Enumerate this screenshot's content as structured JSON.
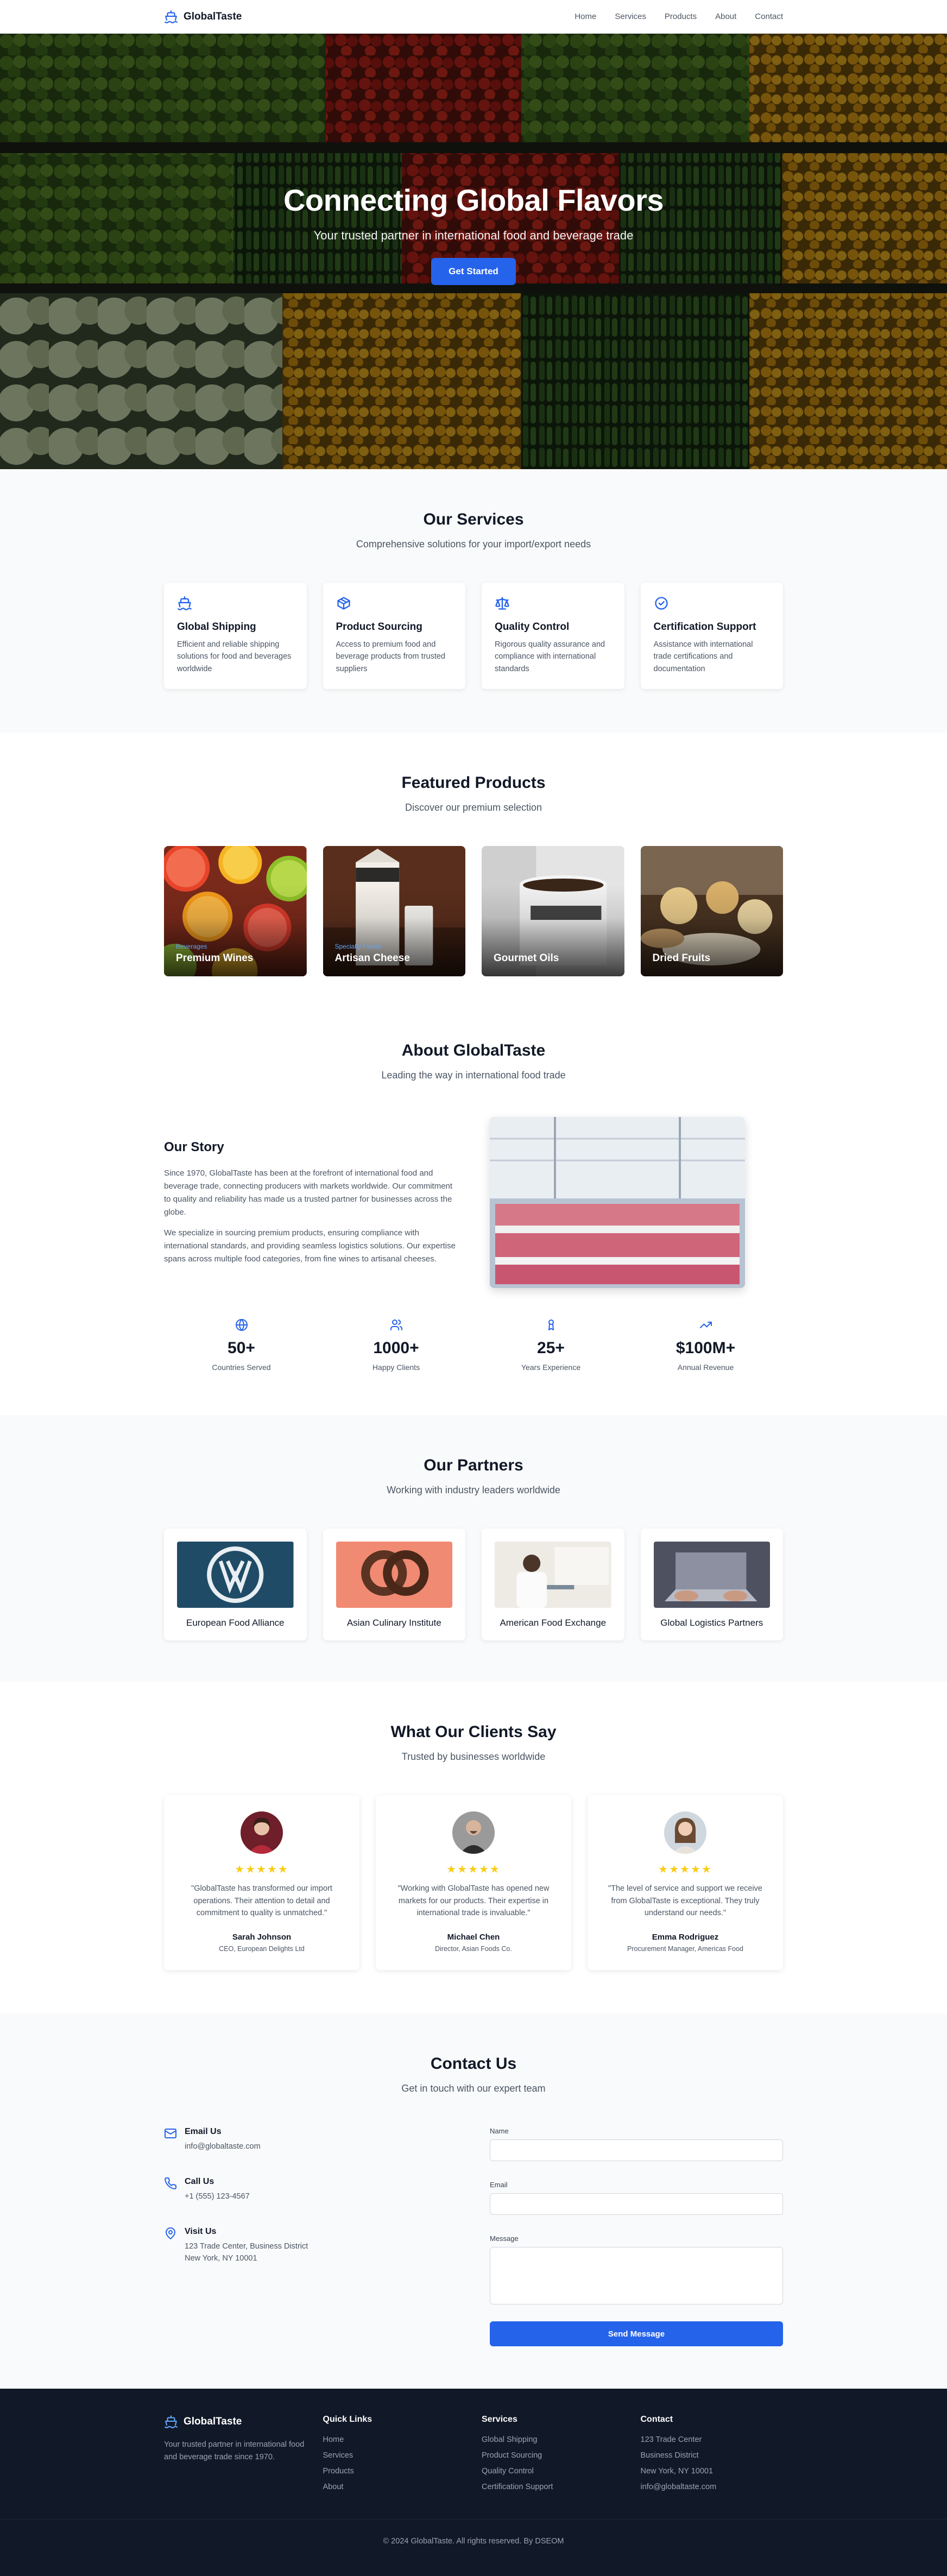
{
  "nav": {
    "brand": "GlobalTaste",
    "links": [
      "Home",
      "Services",
      "Products",
      "About",
      "Contact"
    ]
  },
  "hero": {
    "title": "Connecting Global Flavors",
    "subtitle": "Your trusted partner in international food and beverage trade",
    "cta": "Get Started"
  },
  "services": {
    "title": "Our Services",
    "subtitle": "Comprehensive solutions for your import/export needs",
    "items": [
      {
        "icon": "ship-icon",
        "title": "Global Shipping",
        "desc": "Efficient and reliable shipping solutions for food and beverages worldwide"
      },
      {
        "icon": "box-icon",
        "title": "Product Sourcing",
        "desc": "Access to premium food and beverage products from trusted suppliers"
      },
      {
        "icon": "scale-icon",
        "title": "Quality Control",
        "desc": "Rigorous quality assurance and compliance with international standards"
      },
      {
        "icon": "check-circle-icon",
        "title": "Certification Support",
        "desc": "Assistance with international trade certifications and documentation"
      }
    ]
  },
  "products": {
    "title": "Featured Products",
    "subtitle": "Discover our premium selection",
    "items": [
      {
        "category": "Beverages",
        "name": "Premium Wines"
      },
      {
        "category": "Specialty Foods",
        "name": "Artisan Cheese"
      },
      {
        "category": "",
        "name": "Gourmet Oils"
      },
      {
        "category": "",
        "name": "Dried Fruits"
      }
    ]
  },
  "about": {
    "title": "About GlobalTaste",
    "subtitle": "Leading the way in international food trade",
    "story_title": "Our Story",
    "p1": "Since 1970, GlobalTaste has been at the forefront of international food and beverage trade, connecting producers with markets worldwide. Our commitment to quality and reliability has made us a trusted partner for businesses across the globe.",
    "p2": "We specialize in sourcing premium products, ensuring compliance with international standards, and providing seamless logistics solutions. Our expertise spans across multiple food categories, from fine wines to artisanal cheeses.",
    "stats": [
      {
        "icon": "globe-icon",
        "value": "50+",
        "label": "Countries Served"
      },
      {
        "icon": "users-icon",
        "value": "1000+",
        "label": "Happy Clients"
      },
      {
        "icon": "award-icon",
        "value": "25+",
        "label": "Years Experience"
      },
      {
        "icon": "trending-up-icon",
        "value": "$100M+",
        "label": "Annual Revenue"
      }
    ]
  },
  "partners": {
    "title": "Our Partners",
    "subtitle": "Working with industry leaders worldwide",
    "items": [
      "European Food Alliance",
      "Asian Culinary Institute",
      "American Food Exchange",
      "Global Logistics Partners"
    ]
  },
  "testimonials": {
    "title": "What Our Clients Say",
    "subtitle": "Trusted by businesses worldwide",
    "stars": "★★★★★",
    "items": [
      {
        "quote": "\"GlobalTaste has transformed our import operations. Their attention to detail and commitment to quality is unmatched.\"",
        "name": "Sarah Johnson",
        "role": "CEO, European Delights Ltd"
      },
      {
        "quote": "\"Working with GlobalTaste has opened new markets for our products. Their expertise in international trade is invaluable.\"",
        "name": "Michael Chen",
        "role": "Director, Asian Foods Co."
      },
      {
        "quote": "\"The level of service and support we receive from GlobalTaste is exceptional. They truly understand our needs.\"",
        "name": "Emma Rodriguez",
        "role": "Procurement Manager, Americas Food"
      }
    ]
  },
  "contact": {
    "title": "Contact Us",
    "subtitle": "Get in touch with our expert team",
    "email_title": "Email Us",
    "email": "info@globaltaste.com",
    "call_title": "Call Us",
    "phone": "+1 (555) 123-4567",
    "visit_title": "Visit Us",
    "address1": "123 Trade Center, Business District",
    "address2": "New York, NY 10001",
    "form": {
      "name_label": "Name",
      "email_label": "Email",
      "message_label": "Message",
      "submit": "Send Message"
    }
  },
  "footer": {
    "brand": "GlobalTaste",
    "tagline": "Your trusted partner in international food and beverage trade since 1970.",
    "quick_title": "Quick Links",
    "quick_links": [
      "Home",
      "Services",
      "Products",
      "About"
    ],
    "services_title": "Services",
    "services_links": [
      "Global Shipping",
      "Product Sourcing",
      "Quality Control",
      "Certification Support"
    ],
    "contact_title": "Contact",
    "contact_lines": [
      "123 Trade Center",
      "Business District",
      "New York, NY 10001",
      "info@globaltaste.com"
    ],
    "copyright": "© 2024 GlobalTaste. All rights reserved. By DSEOM"
  },
  "colors": {
    "accent": "#2563eb",
    "footer_bg": "#111827",
    "section_gray": "#f9fafb",
    "star": "#facc15"
  }
}
